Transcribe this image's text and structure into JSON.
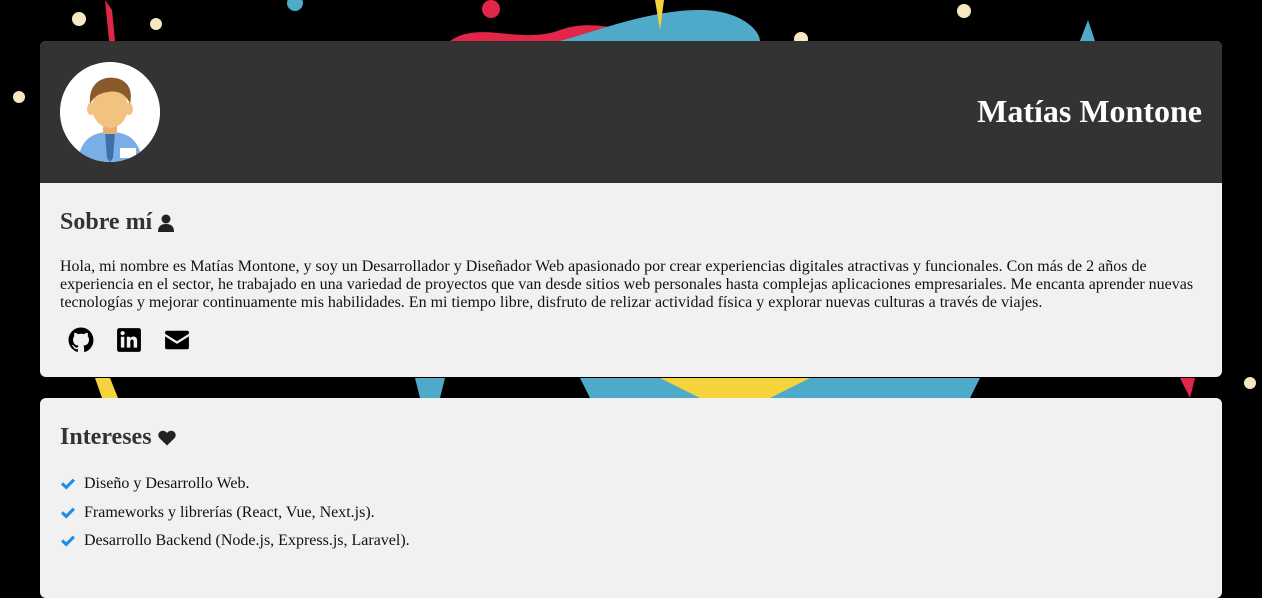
{
  "profile": {
    "name": "Matías Montone"
  },
  "about": {
    "title": "Sobre mí",
    "icon": "user-icon",
    "text": "Hola, mi nombre es Matías Montone, y soy un Desarrollador y Diseñador Web apasionado por crear experiencias digitales atractivas y funcionales. Con más de 2 años de experiencia en el sector, he trabajado en una variedad de proyectos que van desde sitios web personales hasta complejas aplicaciones empresariales. Me encanta aprender nuevas tecnologías y mejorar continuamente mis habilidades. En mi tiempo libre, disfruto de relizar actividad física y explorar nuevas culturas a través de viajes.",
    "socials": [
      "github-icon",
      "linkedin-icon",
      "envelope-icon"
    ]
  },
  "interests": {
    "title": "Intereses",
    "icon": "heart-icon",
    "items": [
      "Diseño y Desarrollo Web.",
      "Frameworks y librerías (React, Vue, Next.js).",
      "Desarrollo Backend (Node.js, Express.js, Laravel)."
    ]
  },
  "colors": {
    "header_bg": "#333333",
    "card_bg": "#f1f1f1",
    "check_blue": "#1a8fe3",
    "page_bg": "#000000"
  }
}
